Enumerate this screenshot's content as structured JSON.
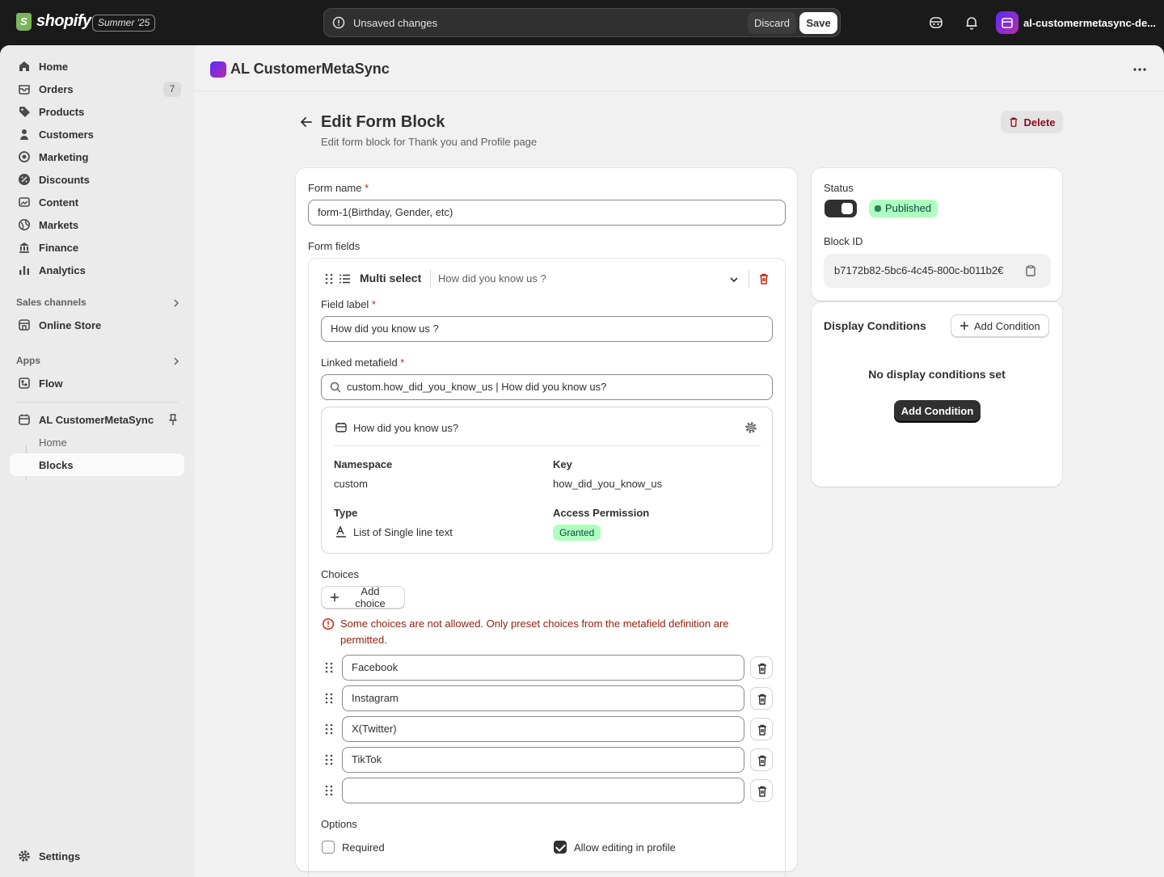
{
  "topbar": {
    "brand": "shopify",
    "edition": "Summer '25",
    "unsaved_message": "Unsaved changes",
    "discard_label": "Discard",
    "save_label": "Save",
    "store_name": "al-customermetasync-de..."
  },
  "sidebar": {
    "items": [
      {
        "label": "Home",
        "icon": "home-icon"
      },
      {
        "label": "Orders",
        "icon": "orders-icon",
        "badge": "7"
      },
      {
        "label": "Products",
        "icon": "tag-icon"
      },
      {
        "label": "Customers",
        "icon": "person-icon"
      },
      {
        "label": "Marketing",
        "icon": "target-icon"
      },
      {
        "label": "Discounts",
        "icon": "discount-icon"
      },
      {
        "label": "Content",
        "icon": "image-icon"
      },
      {
        "label": "Markets",
        "icon": "globe-icon"
      },
      {
        "label": "Finance",
        "icon": "bank-icon"
      },
      {
        "label": "Analytics",
        "icon": "bar-chart-icon"
      }
    ],
    "sales_channels_label": "Sales channels",
    "online_store_label": "Online Store",
    "apps_label": "Apps",
    "flow_label": "Flow",
    "app_label": "AL CustomerMetaSync",
    "app_sub": [
      "Home",
      "Blocks"
    ],
    "settings_label": "Settings"
  },
  "app_header": {
    "title": "AL CustomerMetaSync"
  },
  "page": {
    "title": "Edit Form Block",
    "subtitle": "Edit form block for Thank you and Profile page",
    "delete_label": "Delete"
  },
  "form": {
    "name_label": "Form name",
    "name_value": "form-1(Birthday, Gender, etc)",
    "fields_label": "Form fields",
    "field": {
      "type": "Multi select",
      "summary": "How did you know us ?",
      "label_label": "Field label",
      "label_value": "How did you know us ?",
      "metafield_label": "Linked metafield",
      "metafield_value": "custom.how_did_you_know_us | How did you know us?",
      "meta": {
        "title": "How did you know us?",
        "namespace_label": "Namespace",
        "namespace": "custom",
        "key_label": "Key",
        "key": "how_did_you_know_us",
        "type_label": "Type",
        "type": "List of Single line text",
        "access_label": "Access Permission",
        "access": "Granted"
      },
      "choices_label": "Choices",
      "add_choice_label": "Add choice",
      "error": "Some choices are not allowed. Only preset choices from the metafield definition are permitted.",
      "choices": [
        "Facebook",
        "Instagram",
        "X(Twitter)",
        "TikTok",
        ""
      ],
      "options_label": "Options",
      "required_label": "Required",
      "required_checked": false,
      "allow_edit_label": "Allow editing in profile",
      "allow_edit_checked": true
    }
  },
  "status": {
    "label": "Status",
    "enabled": true,
    "badge": "Published",
    "block_id_label": "Block ID",
    "block_id": "b7172b82-5bc6-4c45-800c-b011b2€"
  },
  "conditions": {
    "title": "Display Conditions",
    "add_label": "Add Condition",
    "empty": "No display conditions set",
    "primary_label": "Add Condition"
  },
  "colors": {
    "accent_dark": "#303030",
    "success_bg": "#affebf",
    "critical": "#8e1f0b"
  }
}
